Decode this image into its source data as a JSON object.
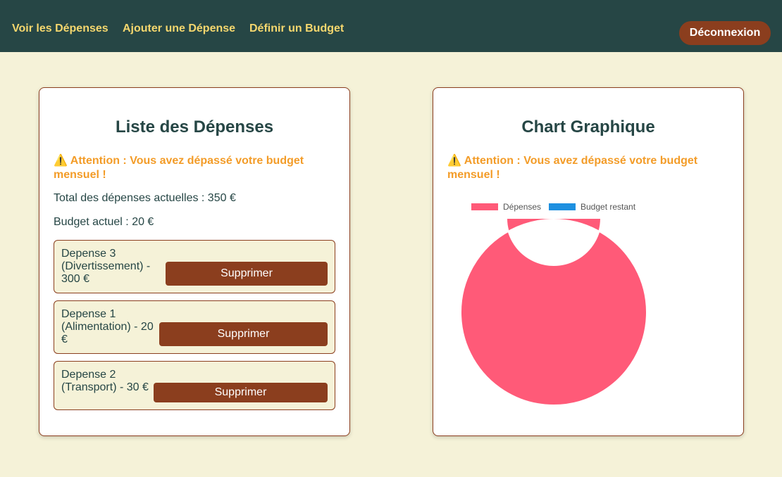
{
  "nav": {
    "links": [
      "Voir les Dépenses",
      "Ajouter une Dépense",
      "Définir un Budget"
    ],
    "logout_label": "Déconnexion"
  },
  "list_card": {
    "title": "Liste des Dépenses",
    "alert": "Attention : Vous avez dépassé votre budget mensuel !",
    "total_text": "Total des dépenses actuelles : 350 €",
    "budget_text": "Budget actuel : 20 €",
    "expenses": [
      {
        "line1": "Depense 3",
        "line2": "(Divertissement) -",
        "line3": "300 €",
        "delete_label": "Supprimer"
      },
      {
        "line1": "Depense 1",
        "line2": "(Alimentation) - 20",
        "line3": "€",
        "delete_label": "Supprimer"
      },
      {
        "line1": "Depense 2",
        "line2": "(Transport) - 30 €",
        "line3": "",
        "delete_label": "Supprimer"
      }
    ]
  },
  "chart_card": {
    "title": "Chart Graphique",
    "alert": "Attention : Vous avez dépassé votre budget mensuel !"
  },
  "warning_icon": "warning-icon",
  "colors": {
    "nav_bg": "#264645",
    "nav_link": "#f5d76e",
    "accent_brown": "#8b3e1e",
    "alert_orange": "#f39c28",
    "page_bg": "#f5f2d8",
    "depenses": "#ff5a78",
    "budget_restant": "#1e90e0"
  },
  "chart_data": {
    "type": "pie",
    "categories": [
      "Dépenses",
      "Budget restant"
    ],
    "values": [
      350,
      0
    ],
    "legend_position": "top"
  }
}
